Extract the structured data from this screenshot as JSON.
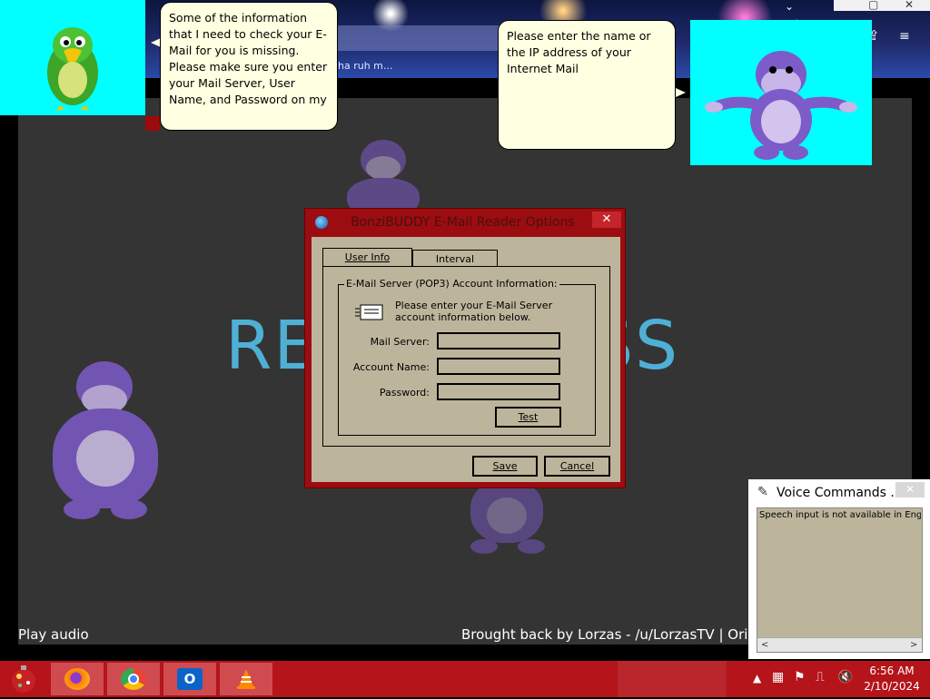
{
  "browser": {
    "tab_text": "ha ruh m...",
    "chevron": "⌄",
    "minimize": "▢",
    "close": "✕",
    "menu_icon": "≡",
    "share_icon": "⇪"
  },
  "page": {
    "big_title_left": "RE",
    "big_title_right": "SS",
    "play_audio": "Play audio",
    "credits": "Brought back by Lorzas - /u/LorzasTV | Origin"
  },
  "balloons": {
    "peedy": "Some of the information that I need to check your E-Mail for you is missing. Please make sure you enter your Mail Server, User Name, and Password on my",
    "bonzi": "Please enter the name or the IP address of your Internet Mail"
  },
  "dialog": {
    "title": "BonziBUDDY E-Mail Reader Options",
    "close": "✕",
    "tabs": [
      "User Info",
      "Interval"
    ],
    "group_label": "E-Mail Server (POP3) Account Information:",
    "description": "Please enter your E-Mail Server account information below.",
    "fields": {
      "mail_server_label": "Mail Server:",
      "mail_server_value": "",
      "account_name_label": "Account Name:",
      "account_name_value": "",
      "password_label": "Password:",
      "password_value": ""
    },
    "buttons": {
      "test": "Test",
      "save": "Save",
      "cancel": "Cancel"
    }
  },
  "voice": {
    "title": "Voice Commands ...",
    "close": "✕",
    "text": "Speech input is not available in English",
    "scroll_left": "<",
    "scroll_right": ">"
  },
  "taskbar": {
    "apps": [
      "firefox-icon",
      "chrome-icon",
      "outlook-icon",
      "vlc-icon"
    ],
    "tray": {
      "up_arrow": "▲",
      "time": "6:56 AM",
      "date": "2/10/2024"
    },
    "colors": {
      "taskbar": "#b4141a",
      "item": "#d04b4f"
    }
  }
}
